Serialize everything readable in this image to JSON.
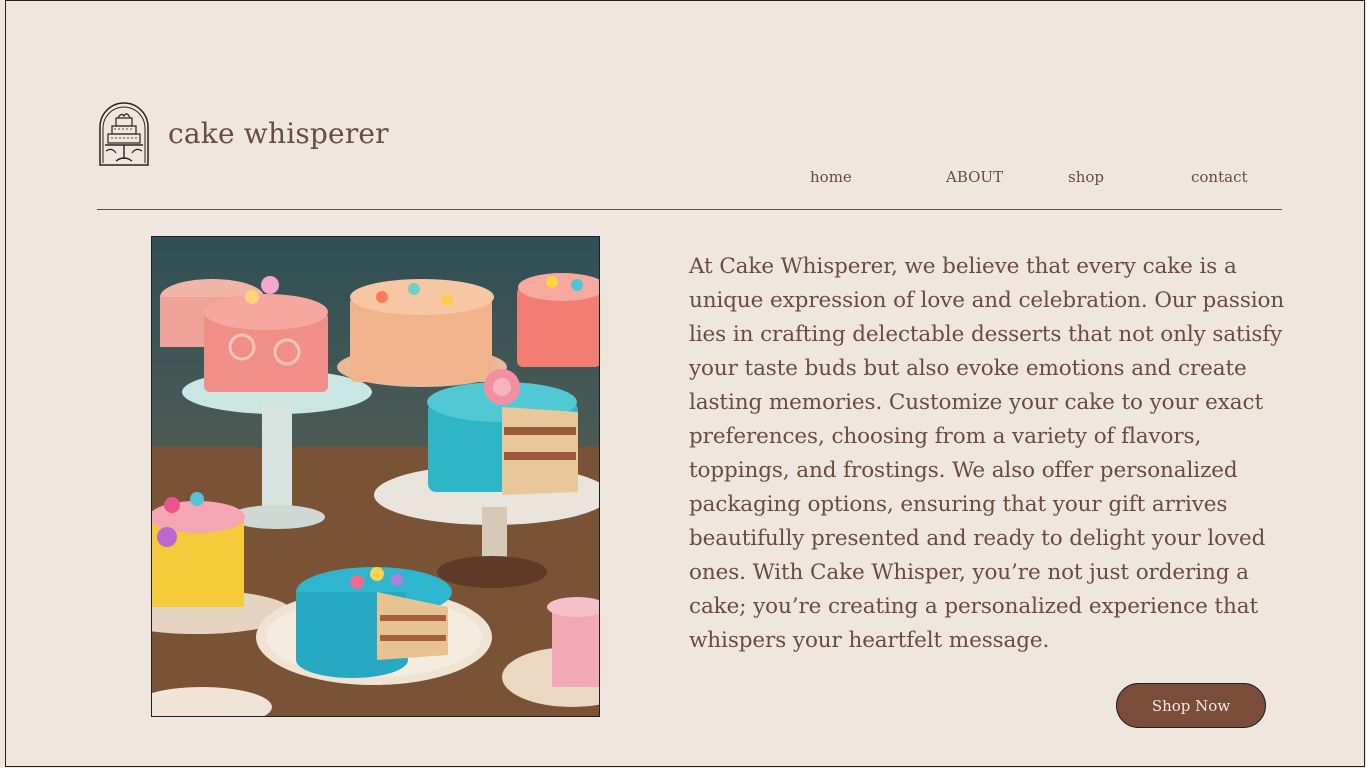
{
  "brand": {
    "name": "cake whisperer",
    "logo_icon": "cake-stand-logo-icon"
  },
  "nav": {
    "home": "home",
    "about": "ABOUT",
    "shop": "shop",
    "contact": "contact"
  },
  "hero": {
    "image_alt": "Decorated cakes on stands",
    "description": "At Cake Whisperer, we believe that every cake is a unique expression of love and celebration. Our passion lies in crafting delectable desserts that not only satisfy your taste buds but also evoke emotions and create lasting memories. Customize your cake to your exact preferences, choosing from a variety of flavors, toppings, and frostings. We also offer personalized packaging options, ensuring that your gift arrives beautifully presented and ready to delight your loved ones. With Cake Whisper, you’re not just ordering a cake; you’re creating a personalized experience that whispers your heartfelt message.",
    "cta_label": "Shop Now"
  },
  "colors": {
    "background": "#efe6dd",
    "text": "#6b4b3e",
    "button": "#7a4d3a",
    "button_text": "#f3e9e0"
  }
}
